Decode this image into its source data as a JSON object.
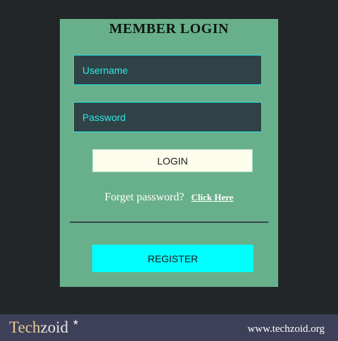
{
  "login_panel": {
    "title": "MEMBER LOGIN",
    "username_placeholder": "Username",
    "password_placeholder": "Password",
    "login_label": "LOGIN",
    "forgot_text": "Forget password?",
    "forgot_link": "Click Here",
    "register_label": "REGISTER"
  },
  "footer": {
    "brand_part1": "Tech",
    "brand_part2": "zoid",
    "brand_mark": "*",
    "website": "www.techzoid.org"
  },
  "colors": {
    "page_background": "#222628",
    "panel_background": "#68b08b",
    "field_background": "#2f4346",
    "field_accent": "#22e6e6",
    "login_button": "#fdfdec",
    "register_button": "#00ffff",
    "footer_background": "#3d4058",
    "brand_accent": "#e9c790"
  }
}
